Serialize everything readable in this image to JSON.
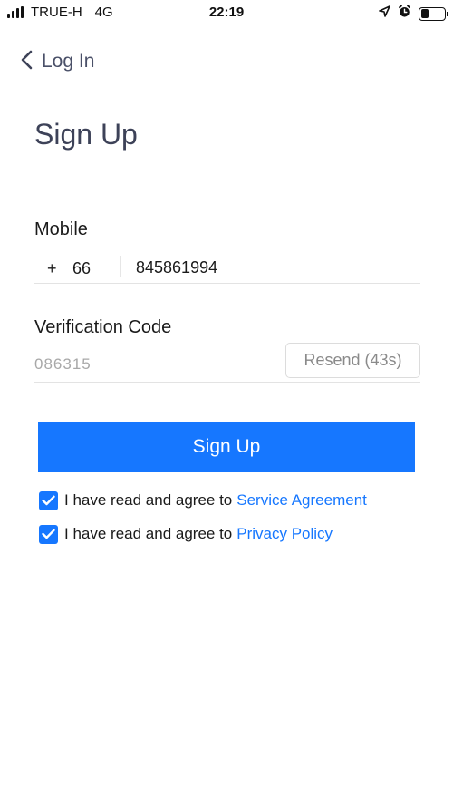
{
  "status_bar": {
    "carrier": "TRUE-H",
    "network": "4G",
    "time": "22:19",
    "battery_level": 0.35
  },
  "nav": {
    "back_label": "Log In"
  },
  "page": {
    "title": "Sign Up"
  },
  "mobile": {
    "label": "Mobile",
    "country_prefix": "+",
    "country_code": "66",
    "phone_value": "845861994"
  },
  "verification": {
    "label": "Verification Code",
    "code_value": "086315",
    "resend_label": "Resend (43s)"
  },
  "signup_button": {
    "label": "Sign Up"
  },
  "agreements": [
    {
      "text": "I have read and agree to",
      "link": "Service Agreement",
      "checked": true
    },
    {
      "text": "I have read and agree to",
      "link": "Privacy Policy",
      "checked": true
    }
  ],
  "colors": {
    "primary": "#1677ff",
    "title": "#3d4258"
  }
}
